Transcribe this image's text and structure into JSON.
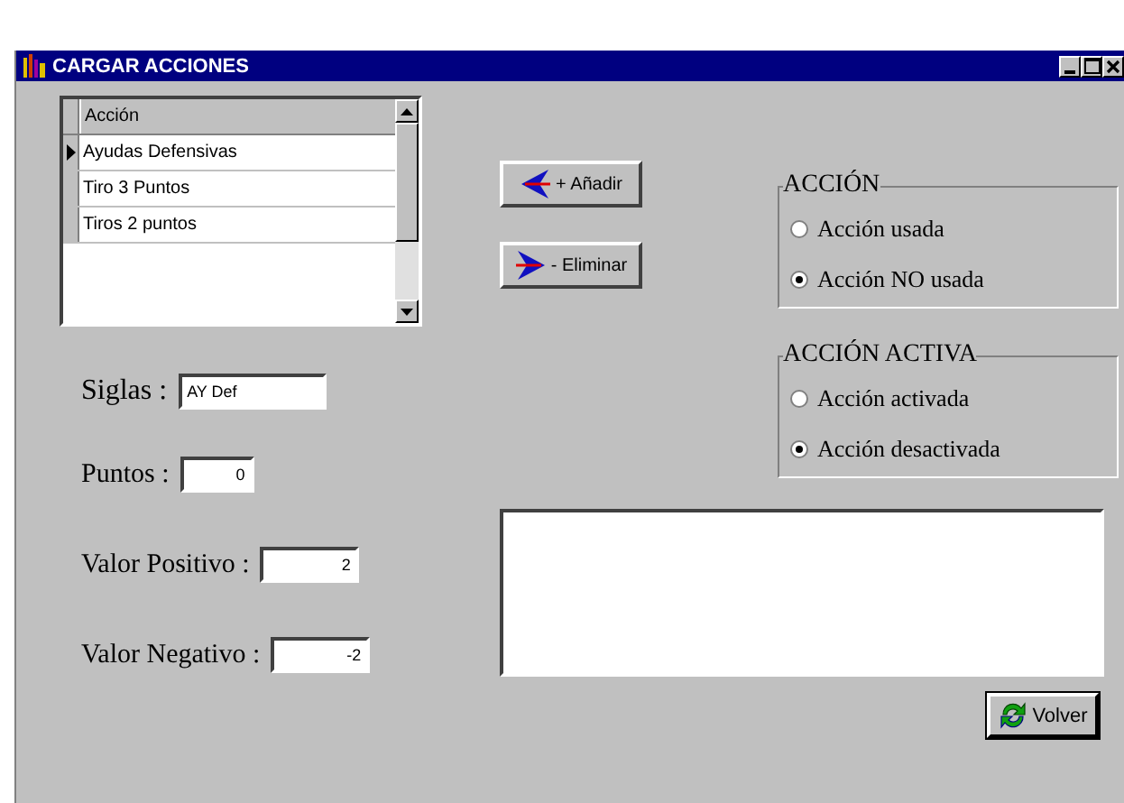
{
  "window": {
    "title": "CARGAR ACCIONES"
  },
  "list": {
    "column": "Acción",
    "rows": [
      {
        "label": "Ayudas Defensivas",
        "selected": true
      },
      {
        "label": "Tiro 3 Puntos",
        "selected": false
      },
      {
        "label": "Tiros 2 puntos",
        "selected": false
      }
    ]
  },
  "actions": [
    {
      "kind": "add",
      "label": "+ Añadir"
    },
    {
      "kind": "remove",
      "label": "- Eliminar"
    }
  ],
  "groups": [
    {
      "title": "ACCIÓN",
      "options": [
        {
          "label": "Acción usada",
          "selected": false
        },
        {
          "label": "Acción NO usada",
          "selected": true
        }
      ]
    },
    {
      "title": "ACCIÓN ACTIVA",
      "options": [
        {
          "label": "Acción activada",
          "selected": false
        },
        {
          "label": "Acción desactivada",
          "selected": true
        }
      ]
    }
  ],
  "fields": [
    {
      "kind": "wide",
      "label": "Siglas :",
      "value": "AY Def"
    },
    {
      "kind": "short",
      "label": "Puntos :",
      "value": "0"
    },
    {
      "kind": "number",
      "label": "Valor Positivo :",
      "value": "2"
    },
    {
      "kind": "number",
      "label": "Valor Negativo :",
      "value": "-2"
    }
  ],
  "back_button": {
    "label": "Volver"
  }
}
